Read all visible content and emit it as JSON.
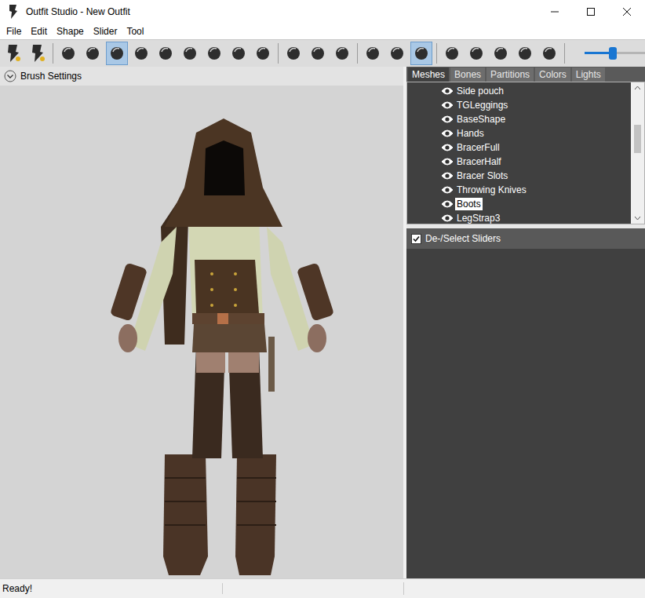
{
  "window": {
    "title": "Outfit Studio - New Outfit"
  },
  "menu": [
    "File",
    "Edit",
    "Shape",
    "Slider",
    "Tool"
  ],
  "toolbar": {
    "groups": [
      [
        {
          "selected": false
        },
        {
          "selected": false
        }
      ],
      [
        {
          "selected": false
        },
        {
          "selected": false
        },
        {
          "selected": true
        },
        {
          "selected": false
        },
        {
          "selected": false
        },
        {
          "selected": false
        },
        {
          "selected": false
        },
        {
          "selected": false
        },
        {
          "selected": false
        }
      ],
      [
        {
          "selected": false
        },
        {
          "selected": false
        },
        {
          "selected": false
        }
      ],
      [
        {
          "selected": false
        },
        {
          "selected": false
        },
        {
          "selected": true
        }
      ],
      [
        {
          "selected": false
        },
        {
          "selected": false
        },
        {
          "selected": false
        },
        {
          "selected": false
        },
        {
          "selected": false
        }
      ]
    ],
    "slider": {
      "level": 0.47
    }
  },
  "brush_settings": {
    "label": "Brush Settings",
    "expanded": false
  },
  "tabs": [
    {
      "label": "Meshes",
      "selected": true
    },
    {
      "label": "Bones",
      "selected": false
    },
    {
      "label": "Partitions",
      "selected": false
    },
    {
      "label": "Colors",
      "selected": false
    },
    {
      "label": "Lights",
      "selected": false
    }
  ],
  "meshes": [
    {
      "name": "Side pouch",
      "visible": true,
      "selected": false
    },
    {
      "name": "TGLeggings",
      "visible": true,
      "selected": false
    },
    {
      "name": "BaseShape",
      "visible": true,
      "selected": false
    },
    {
      "name": "Hands",
      "visible": true,
      "selected": false
    },
    {
      "name": "BracerFull",
      "visible": true,
      "selected": false
    },
    {
      "name": "BracerHalf",
      "visible": true,
      "selected": false
    },
    {
      "name": "Bracer Slots",
      "visible": true,
      "selected": false
    },
    {
      "name": "Throwing Knives",
      "visible": true,
      "selected": false
    },
    {
      "name": "Boots",
      "visible": true,
      "selected": true
    },
    {
      "name": "LegStrap3",
      "visible": true,
      "selected": false
    }
  ],
  "sliders_panel": {
    "label": "De-/Select Sliders",
    "checked": true
  },
  "status_bar": {
    "text": "Ready!"
  }
}
